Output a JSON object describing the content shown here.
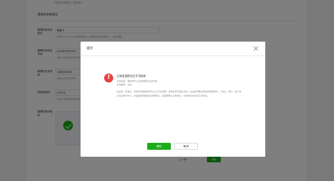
{
  "background": {
    "top_note": "开通后可按照规，提前操作",
    "top_note_link": "提前操作",
    "section_title": "管理员审核验证",
    "fields": [
      {
        "label": "管理员身份证姓名",
        "value": "徐默飞",
        "hint": "需填写与公众平台管理员的姓名，如果名字包含分隔号“·”，请勿省略。"
      },
      {
        "label": "管理员身份证号码",
        "value": "41048219911011",
        "hint": "请输入管理员身份证号码"
      },
      {
        "label": "管理员手机号码",
        "value": "13603626211",
        "hint": "请输入您的手机号码"
      },
      {
        "label": "短信验证码",
        "value": "470770",
        "hint": "请输入手机短信收到的验证码"
      },
      {
        "label": "管理员身份验证",
        "value": "",
        "hint": ""
      }
    ],
    "prev_label": "上一步",
    "next_label": "继续"
  },
  "dialog": {
    "title": "提示",
    "message_title": "主体信息提交后不可修改",
    "line1": "主体名称：濮阳市开心生态种植专业合作社",
    "line2": "主体类型：企业",
    "body": "该主体一旦提交，将成为你微信账号在公众平台的唯一法律主体与签约主体，在后续开展业务和提供服务时，广告主、商户、用户将以该主体为中心，并由其承担相应的法律责任。请谨慎确认主体信息，主体信息提交后不可修改。",
    "ok_label": "确定",
    "cancel_label": "取消"
  },
  "colors": {
    "accent": "#1aad19",
    "warning": "#e64340",
    "mask": "rgba(0,0,0,0.5)"
  },
  "icons": [
    "close-icon",
    "warning-icon",
    "check-circle-icon"
  ]
}
